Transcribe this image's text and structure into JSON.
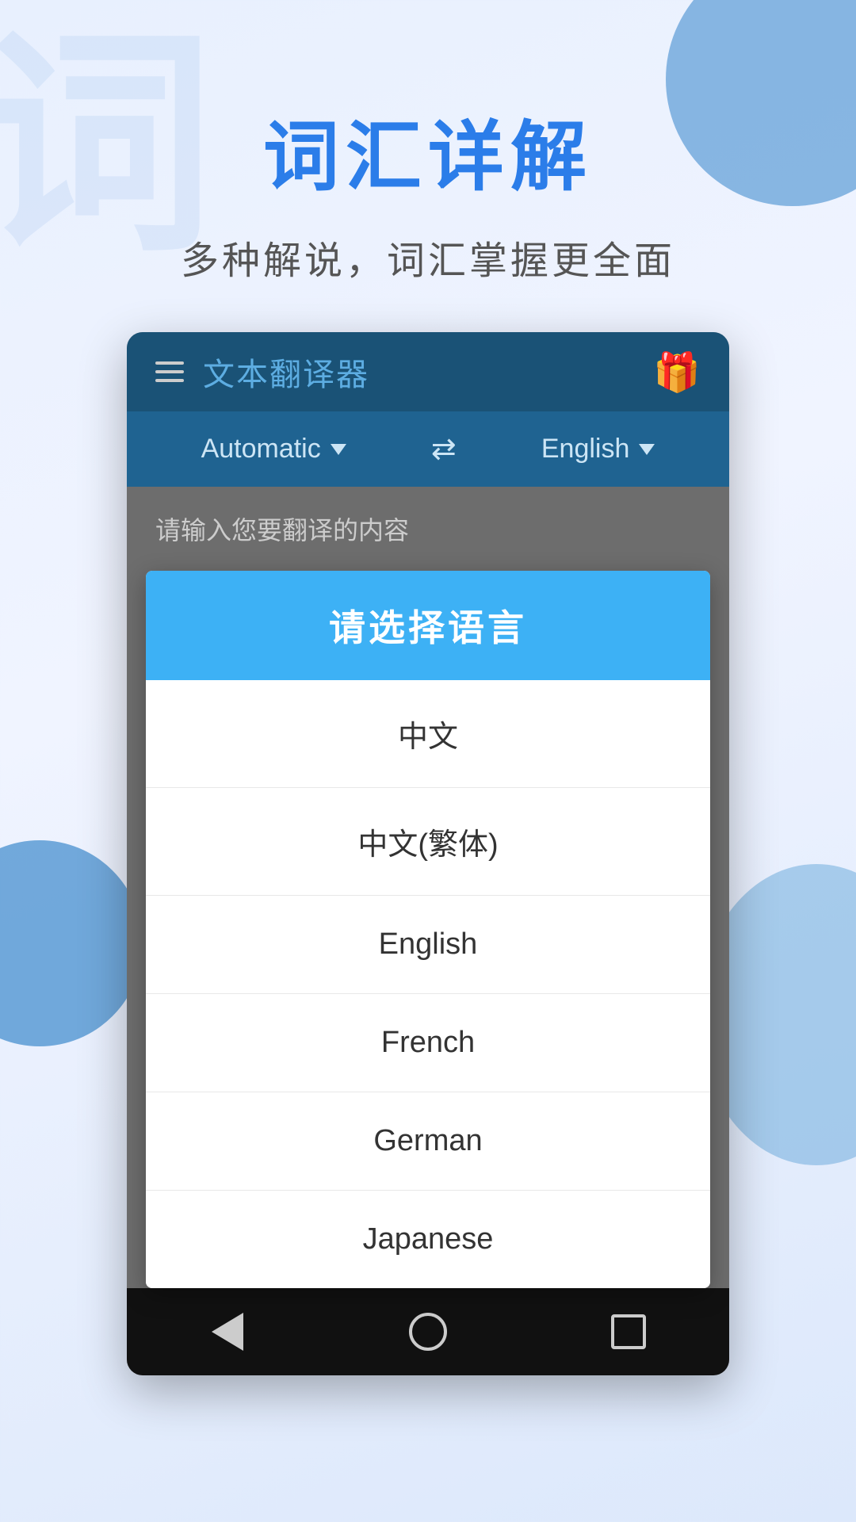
{
  "background": {
    "watermark_text": "词"
  },
  "top_section": {
    "main_title": "词汇详解",
    "subtitle": "多种解说，词汇掌握更全面"
  },
  "app": {
    "header": {
      "title": "文本翻译器",
      "gift_icon": "🎁"
    },
    "lang_bar": {
      "source_lang": "Automatic",
      "target_lang": "English",
      "swap_symbol": "⇄"
    },
    "input_hint": "请输入您要翻译的内容",
    "dialog": {
      "title": "请选择语言",
      "options": [
        {
          "label": "中文"
        },
        {
          "label": "中文(繁体)"
        },
        {
          "label": "English"
        },
        {
          "label": "French"
        },
        {
          "label": "German"
        },
        {
          "label": "Japanese"
        }
      ]
    },
    "nav": {
      "back_label": "back",
      "home_label": "home",
      "recents_label": "recents"
    }
  }
}
